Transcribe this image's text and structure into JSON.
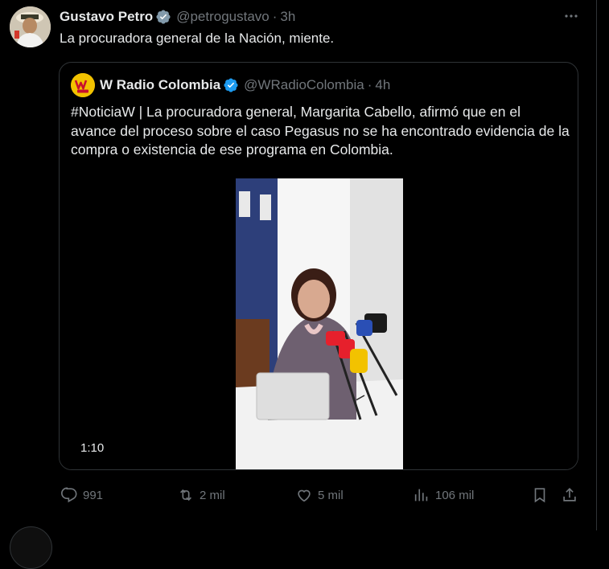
{
  "tweet": {
    "display_name": "Gustavo Petro",
    "handle": "@petrogustavo",
    "separator": "·",
    "time": "3h",
    "text": "La procuradora general de la Nación, miente."
  },
  "quote": {
    "display_name": "W Radio Colombia",
    "handle": "@WRadioColombia",
    "separator": "·",
    "time": "4h",
    "text": "#NoticiaW | La procuradora general, Margarita Cabello, afirmó que en el avance del proceso sobre el caso Pegasus no se ha encontrado evidencia de la compra o existencia de ese programa en Colombia.",
    "video_duration": "1:10"
  },
  "actions": {
    "replies": "991",
    "reposts": "2 mil",
    "likes": "5 mil",
    "views": "106 mil"
  },
  "colors": {
    "background": "#000000",
    "text": "#e7e9ea",
    "muted": "#71767b",
    "border": "#2f3336",
    "verified_blue": "#1d9bf0",
    "verified_gray": "#829aab",
    "wradio_yellow": "#f2c200"
  },
  "icons": [
    "verified-badge-icon",
    "more-icon",
    "reply-icon",
    "repost-icon",
    "like-icon",
    "views-icon",
    "bookmark-icon",
    "share-icon"
  ]
}
